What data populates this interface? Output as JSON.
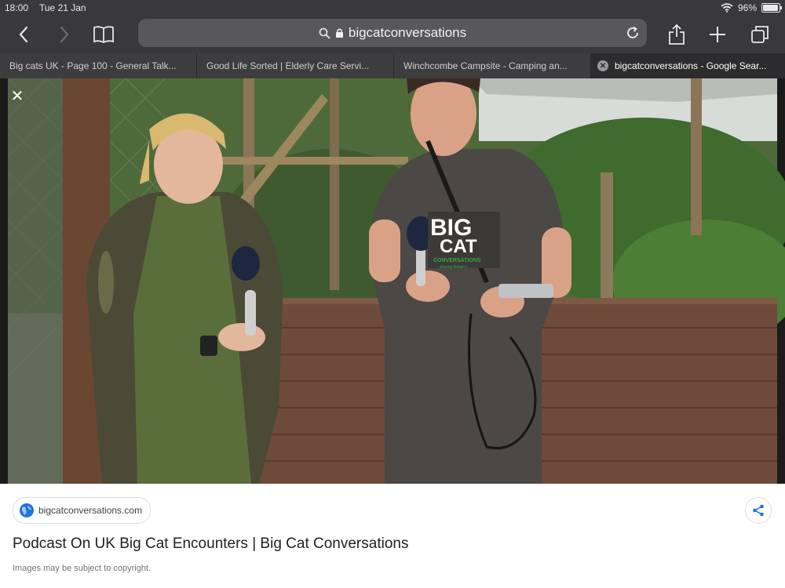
{
  "status": {
    "time": "18:00",
    "date": "Tue 21 Jan",
    "battery": "96%",
    "battery_level": 0.96
  },
  "browser": {
    "url": "bigcatconversations",
    "tabs": [
      {
        "title": "Big cats UK - Page 100 - General Talk..."
      },
      {
        "title": "Good Life Sorted | Elderly Care Servi..."
      },
      {
        "title": "Winchcombe Campsite - Camping an..."
      },
      {
        "title": "bigcatconversations - Google Sear..."
      }
    ]
  },
  "photo": {
    "shirt_logo_line1": "BIG",
    "shirt_logo_line2": "CAT",
    "shirt_logo_line3": "CONVERSATIONS",
    "shirt_logo_line4": "sharing Britain's ..."
  },
  "result": {
    "source": "bigcatconversations.com",
    "title": "Podcast On UK Big Cat Encounters | Big Cat Conversations",
    "copyright": "Images may be subject to copyright."
  },
  "colors": {
    "chrome": "#39393b",
    "url_bar": "#58585b",
    "link_blue": "#1a73e8"
  }
}
